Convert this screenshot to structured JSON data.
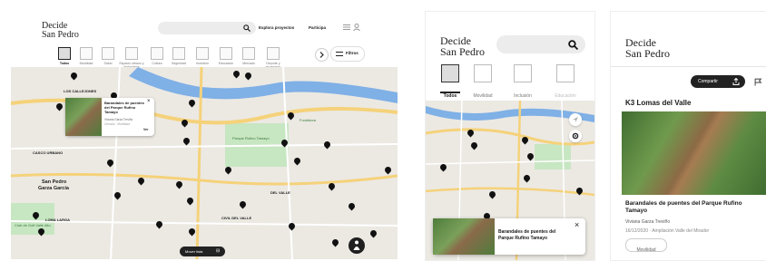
{
  "desktop": {
    "logo_line1": "Decide",
    "logo_line2": "San Pedro",
    "nav": {
      "explore": "Explora proyectos",
      "participate": "Participa"
    },
    "filter_label": "Filtros",
    "categories": [
      "Todos",
      "Movilidad",
      "Salud",
      "Espacio urbano y Naturaleza",
      "Cultura",
      "Seguridad",
      "Inclusión",
      "Educación",
      "Mercado",
      "Deporte y recreación"
    ],
    "popup": {
      "title": "Barandales de puentes del Parque Rufino Tamayo",
      "subtitle": "Viviana Garza Treviño",
      "meta": "Cerrado · Movilidad",
      "link": "Ver"
    },
    "map_button": "Mover lista",
    "map_labels": [
      {
        "text": "LOS CALLEJONES",
        "color": "#333"
      },
      {
        "text": "CASCO URBANO",
        "color": "#333"
      },
      {
        "text": "San Pedro",
        "color": "#222"
      },
      {
        "text": "Garza García",
        "color": "#222"
      },
      {
        "text": "DEL VALLE",
        "color": "#333"
      },
      {
        "text": "LOMA LARGA",
        "color": "#333"
      },
      {
        "text": "CIVIL DEL VALLE",
        "color": "#333"
      },
      {
        "text": "Club de Golf Valle Alto",
        "color": "#3a7a3a"
      },
      {
        "text": "Parque Rufino Tamayo",
        "color": "#3a7a3a"
      },
      {
        "text": "Fundidora",
        "color": "#3a7a3a"
      }
    ]
  },
  "mobile_map": {
    "logo_line1": "Decide",
    "logo_line2": "San Pedro",
    "tabs": [
      "Todos",
      "Movilidad",
      "Inclusión",
      "Educación"
    ],
    "card_title": "Barandales de puentes del Parque Rufino Tamayo",
    "close": "×"
  },
  "mobile_detail": {
    "logo_line1": "Decide",
    "logo_line2": "San Pedro",
    "share_label": "Compartir",
    "section_title": "K3 Lomas del Valle",
    "project_title": "Barandales de puentes del Parque Rufino Tamayo",
    "author": "Viviana Garza Treviño",
    "meta": "16/12/2020 · Ampliación Valle del Mirador",
    "tag": "Movilidad"
  },
  "icons": [
    "search-icon",
    "menu-icon",
    "user-icon",
    "chevron-right-icon",
    "filter-icon",
    "close-icon",
    "location-arrow-icon",
    "gear-icon",
    "share-icon",
    "flag-icon",
    "person-icon"
  ],
  "colors": {
    "map_bg": "#ece9e3",
    "river": "#7fb0e6",
    "highway": "#f5d27a",
    "park": "#c7e6c2",
    "label_red": "#c0392b",
    "label_orange": "#d4791a",
    "dark": "#222222"
  }
}
